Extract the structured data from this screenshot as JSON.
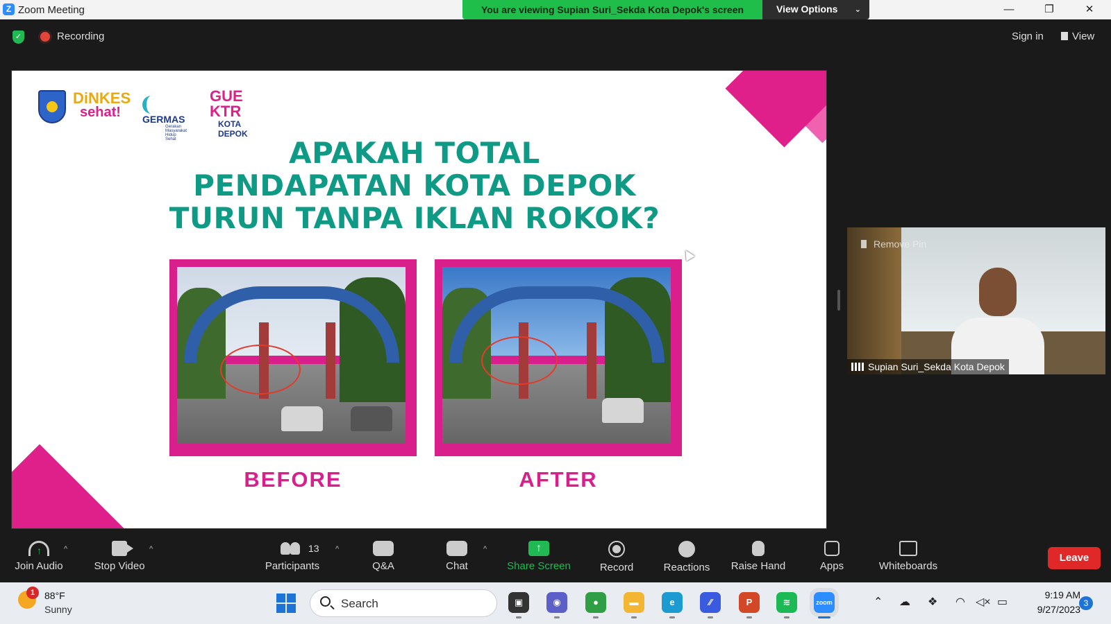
{
  "window": {
    "title": "Zoom Meeting",
    "share_banner": "You are viewing Supian Suri_Sekda Kota Depok's screen",
    "view_options": "View Options",
    "controls": {
      "minimize": "—",
      "restore": "❐",
      "close": "✕"
    }
  },
  "topbar": {
    "recording_label": "Recording",
    "sign_in": "Sign in",
    "view": "View"
  },
  "slide": {
    "logos": {
      "dinkes_top": "DiNKES",
      "dinkes_bottom": "sehat!",
      "germas": "GERMAS",
      "germas_sub": "Gerakan Masyarakat Hidup Sehat",
      "guektr_top": "GUE KTR",
      "guektr_bottom": "KOTA DEPOK"
    },
    "title_lines": [
      "APAKAH TOTAL",
      "PENDAPATAN KOTA DEPOK",
      "TURUN TANPA IKLAN ROKOK?"
    ],
    "photos": [
      {
        "caption": "BEFORE"
      },
      {
        "caption": "AFTER"
      }
    ],
    "colors": {
      "title": "#0f9a86",
      "accent": "#d81f8c"
    }
  },
  "video_tile": {
    "pin_label": "Remove Pin",
    "participant_name": "Supian Suri_Sekda Kota Depok"
  },
  "toolbar": {
    "join_audio": "Join Audio",
    "stop_video": "Stop Video",
    "participants": "Participants",
    "participants_count": "13",
    "qa": "Q&A",
    "chat": "Chat",
    "share_screen": "Share Screen",
    "record": "Record",
    "reactions": "Reactions",
    "raise_hand": "Raise Hand",
    "apps": "Apps",
    "whiteboards": "Whiteboards",
    "leave": "Leave"
  },
  "taskbar": {
    "weather_badge": "1",
    "weather_temp": "88°F",
    "weather_condition": "Sunny",
    "search_placeholder": "Search",
    "apps": [
      {
        "name": "task-view",
        "glyph": "▣",
        "color": "#333333"
      },
      {
        "name": "meet",
        "glyph": "◉",
        "color": "#5b5fc7"
      },
      {
        "name": "chrome",
        "glyph": "●",
        "color": "#2f9e44"
      },
      {
        "name": "file-explorer",
        "glyph": "▬",
        "color": "#f2b632"
      },
      {
        "name": "edge",
        "glyph": "e",
        "color": "#1b9bd1"
      },
      {
        "name": "app-blue",
        "glyph": "∕∕",
        "color": "#3a5be0"
      },
      {
        "name": "powerpoint",
        "glyph": "P",
        "color": "#d24726"
      },
      {
        "name": "spotify",
        "glyph": "≋",
        "color": "#1db954"
      },
      {
        "name": "zoom",
        "glyph": "zoom",
        "color": "#2d8cff"
      }
    ],
    "time": "9:19 AM",
    "date": "9/27/2023",
    "notifications": "3"
  }
}
